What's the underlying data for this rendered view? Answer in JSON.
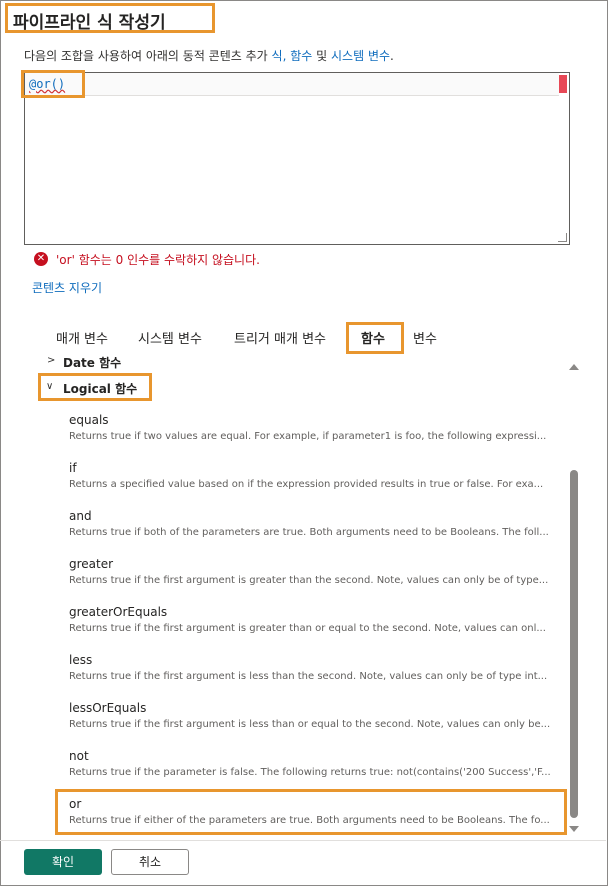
{
  "header": {
    "title": "파이프라인 식 작성기"
  },
  "description": {
    "prefix": "다음의 조합을 사용하여 아래의 동적 콘텐츠 추가",
    "link_expr": "식,",
    "link_func": "함수",
    "middle": "및",
    "link_sys": "시스템 변수",
    "suffix": "."
  },
  "editor": {
    "value": "@or()"
  },
  "error": {
    "message": "'or' 함수는 0 인수를 수락하지 않습니다."
  },
  "clear_label": "콘텐츠 지우기",
  "tabs": [
    {
      "label": "매개 변수"
    },
    {
      "label": "시스템 변수"
    },
    {
      "label": "트리거 매개 변수"
    },
    {
      "label": "함수"
    },
    {
      "label": "변수"
    }
  ],
  "categories": {
    "date": "Date 함수",
    "logical": "Logical 함수"
  },
  "functions": [
    {
      "name": "equals",
      "desc": "Returns true if two values are equal. For example, if parameter1 is foo, the following expressi..."
    },
    {
      "name": "if",
      "desc": "Returns a specified value based on if the expression provided results in true or false. For exa..."
    },
    {
      "name": "and",
      "desc": "Returns true if both of the parameters are true. Both arguments need to be Booleans. The foll..."
    },
    {
      "name": "greater",
      "desc": "Returns true if the first argument is greater than the second. Note, values can only be of type..."
    },
    {
      "name": "greaterOrEquals",
      "desc": "Returns true if the first argument is greater than or equal to the second. Note, values can onl..."
    },
    {
      "name": "less",
      "desc": "Returns true if the first argument is less than the second. Note, values can only be of type int..."
    },
    {
      "name": "lessOrEquals",
      "desc": "Returns true if the first argument is less than or equal to the second. Note, values can only be..."
    },
    {
      "name": "not",
      "desc": "Returns true if the parameter is false. The following returns true: not(contains('200 Success','F..."
    },
    {
      "name": "or",
      "desc": "Returns true if either of the parameters are true. Both arguments need to be Booleans. The fo..."
    }
  ],
  "footer": {
    "ok": "확인",
    "cancel": "취소"
  },
  "colors": {
    "highlight": "#e8962e",
    "primary": "#117865",
    "link": "#0f6cbd",
    "error": "#c50f1f"
  }
}
